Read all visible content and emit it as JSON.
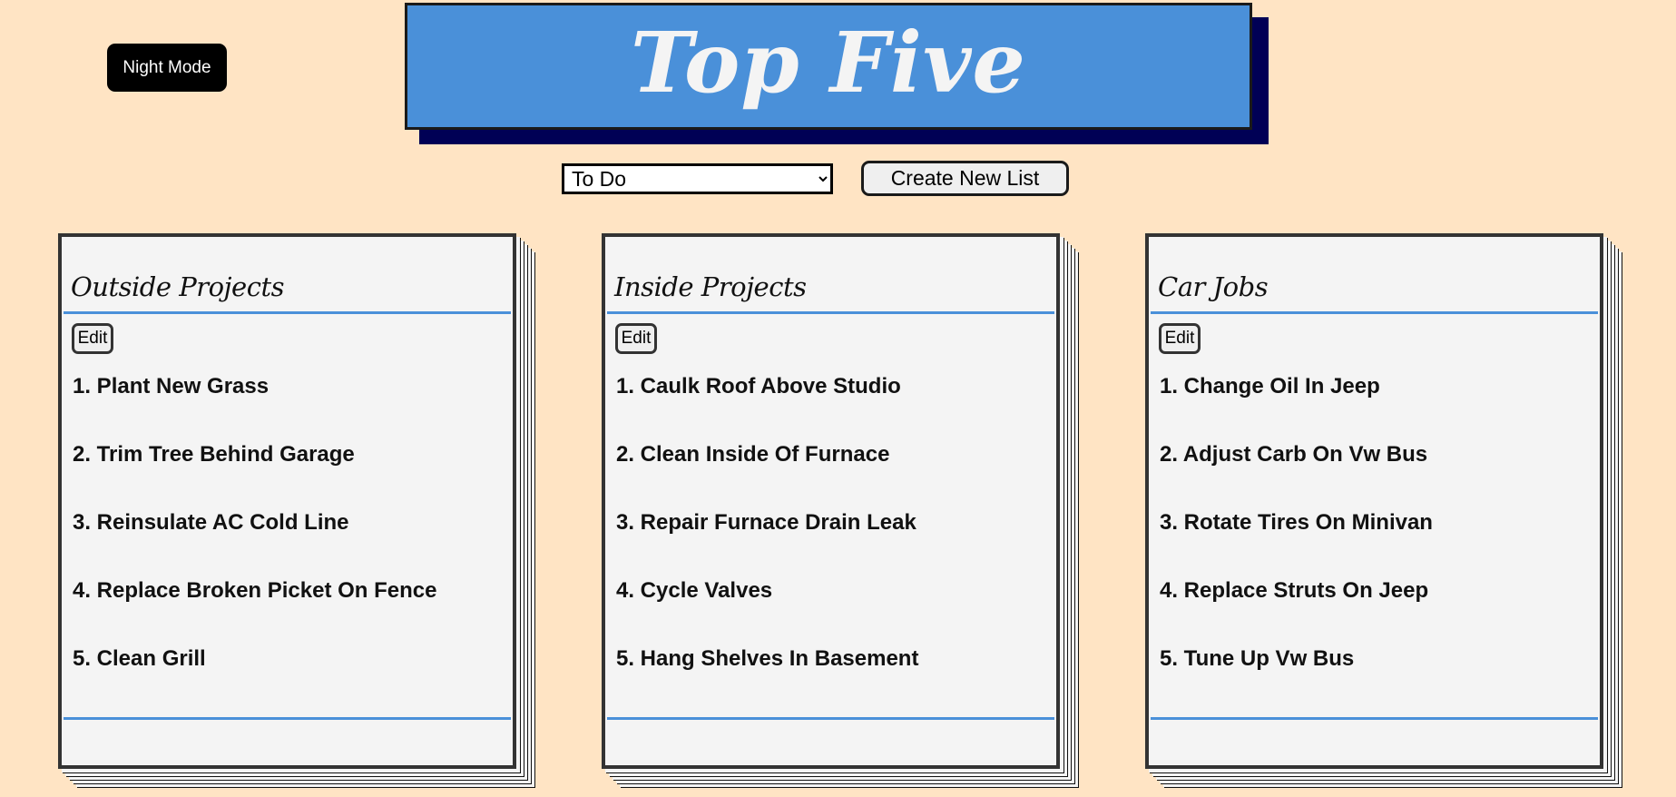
{
  "header": {
    "night_mode_label": "Night Mode",
    "title": "Top Five"
  },
  "controls": {
    "selected_list": "To Do",
    "create_label": "Create New List"
  },
  "colors": {
    "background": "#ffe4c4",
    "accent_blue": "#4a90d9",
    "banner_shadow": "#000055",
    "card": "#f4f4f4"
  },
  "lists": [
    {
      "title": "Outside Projects",
      "edit_label": "Edit",
      "items": [
        "1. Plant New Grass",
        "2. Trim Tree Behind Garage",
        "3. Reinsulate AC Cold Line",
        "4. Replace Broken Picket On Fence",
        "5. Clean Grill"
      ]
    },
    {
      "title": "Inside Projects",
      "edit_label": "Edit",
      "items": [
        "1. Caulk Roof Above Studio",
        "2. Clean Inside Of Furnace",
        "3. Repair Furnace Drain Leak",
        "4. Cycle Valves",
        "5. Hang Shelves In Basement"
      ]
    },
    {
      "title": "Car Jobs",
      "edit_label": "Edit",
      "items": [
        "1. Change Oil In Jeep",
        "2. Adjust Carb On Vw Bus",
        "3. Rotate Tires On Minivan",
        "4. Replace Struts On Jeep",
        "5. Tune Up Vw Bus"
      ]
    }
  ]
}
